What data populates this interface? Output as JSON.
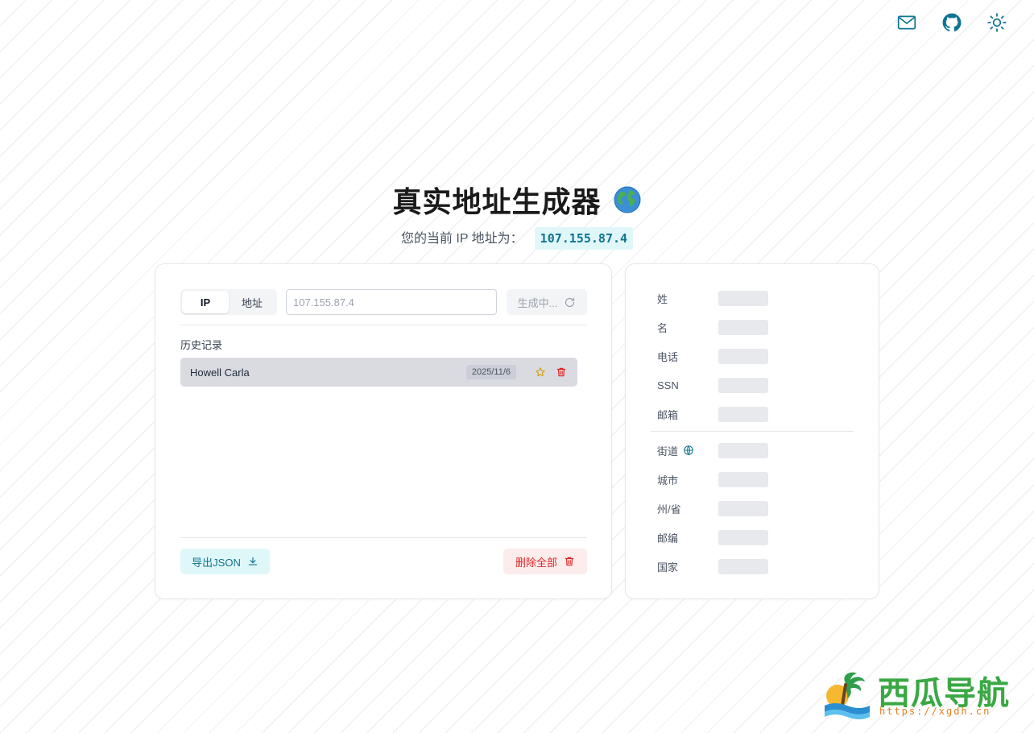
{
  "header": {
    "title": "真实地址生成器",
    "ip_prefix": "您的当前 IP 地址为：",
    "ip_value": "107.155.87.4"
  },
  "toolbar": {
    "icons": [
      "mail-icon",
      "github-icon",
      "sun-icon"
    ]
  },
  "form": {
    "tabs": [
      {
        "label": "IP",
        "active": true
      },
      {
        "label": "地址",
        "active": false
      }
    ],
    "input_value": "",
    "input_placeholder": "107.155.87.4",
    "generate_label": "生成中..."
  },
  "history": {
    "label": "历史记录",
    "items": [
      {
        "name": "Howell Carla",
        "date": "2025/11/6"
      }
    ]
  },
  "actions": {
    "export_label": "导出JSON",
    "delete_all_label": "删除全部"
  },
  "details": {
    "fields": [
      {
        "label": "姓"
      },
      {
        "label": "名"
      },
      {
        "label": "电话"
      },
      {
        "label": "SSN"
      },
      {
        "label": "邮箱"
      },
      {
        "label": "街道"
      },
      {
        "label": "城市"
      },
      {
        "label": "州/省"
      },
      {
        "label": "邮编"
      },
      {
        "label": "国家"
      }
    ]
  },
  "watermark": {
    "text": "西瓜导航",
    "url": "https://xgdh.cn"
  },
  "colors": {
    "accent": "#0e7490",
    "accent_bg": "#e0f7fa",
    "danger": "#dc2626",
    "danger_bg": "#fdecec",
    "star": "#d4a017"
  }
}
